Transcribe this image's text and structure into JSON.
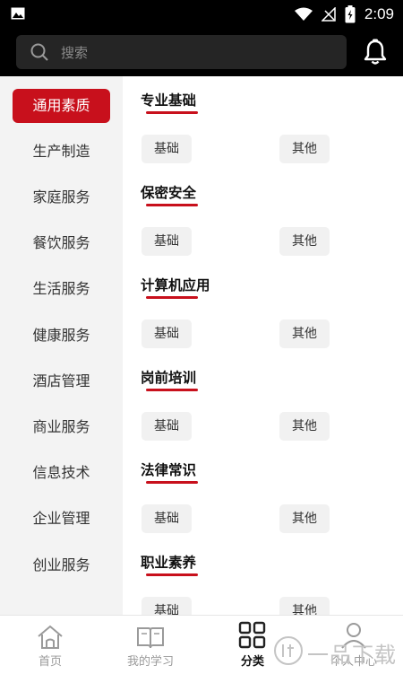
{
  "status_bar": {
    "time": "2:09"
  },
  "search": {
    "placeholder": "搜索"
  },
  "sidebar": {
    "items": [
      {
        "label": "通用素质",
        "active": true
      },
      {
        "label": "生产制造"
      },
      {
        "label": "家庭服务"
      },
      {
        "label": "餐饮服务"
      },
      {
        "label": "生活服务"
      },
      {
        "label": "健康服务"
      },
      {
        "label": "酒店管理"
      },
      {
        "label": "商业服务"
      },
      {
        "label": "信息技术"
      },
      {
        "label": "企业管理"
      },
      {
        "label": "创业服务"
      }
    ]
  },
  "sections": [
    {
      "title": "专业基础",
      "chips": [
        "基础",
        "其他"
      ]
    },
    {
      "title": "保密安全",
      "chips": [
        "基础",
        "其他"
      ]
    },
    {
      "title": "计算机应用",
      "chips": [
        "基础",
        "其他"
      ]
    },
    {
      "title": "岗前培训",
      "chips": [
        "基础",
        "其他"
      ]
    },
    {
      "title": "法律常识",
      "chips": [
        "基础",
        "其他"
      ]
    },
    {
      "title": "职业素养",
      "chips": [
        "基础",
        "其他"
      ]
    }
  ],
  "tabbar": {
    "items": [
      {
        "label": "首页",
        "icon": "home-icon"
      },
      {
        "label": "我的学习",
        "icon": "book-icon"
      },
      {
        "label": "分类",
        "icon": "grid-icon",
        "active": true
      },
      {
        "label": "个人中心",
        "icon": "person-icon"
      }
    ]
  },
  "watermark": {
    "text": "一品下载"
  },
  "colors": {
    "accent": "#c8101c",
    "header_bg": "#000000",
    "sidebar_bg": "#f3f3f3"
  }
}
